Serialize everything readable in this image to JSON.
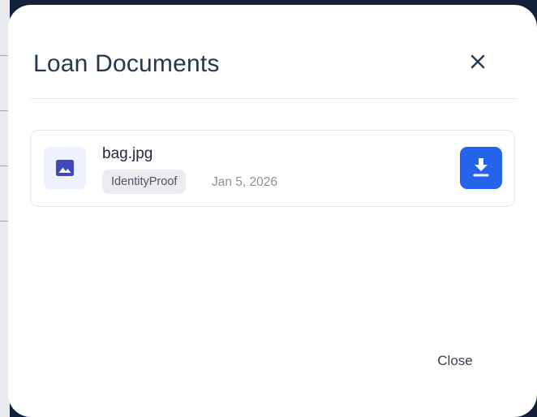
{
  "modal": {
    "title": "Loan Documents",
    "close_label": "Close"
  },
  "documents": [
    {
      "file_name": "bag.jpg",
      "doc_type": "IdentityProof",
      "date": "Jan 5, 2026"
    }
  ],
  "icons": {
    "file": "image-icon",
    "download": "download-icon",
    "close": "close-icon"
  },
  "colors": {
    "accent": "#2563eb",
    "icon_bg": "#eef2fe",
    "icon_fg": "#3f4ab8",
    "title": "#25384f"
  }
}
